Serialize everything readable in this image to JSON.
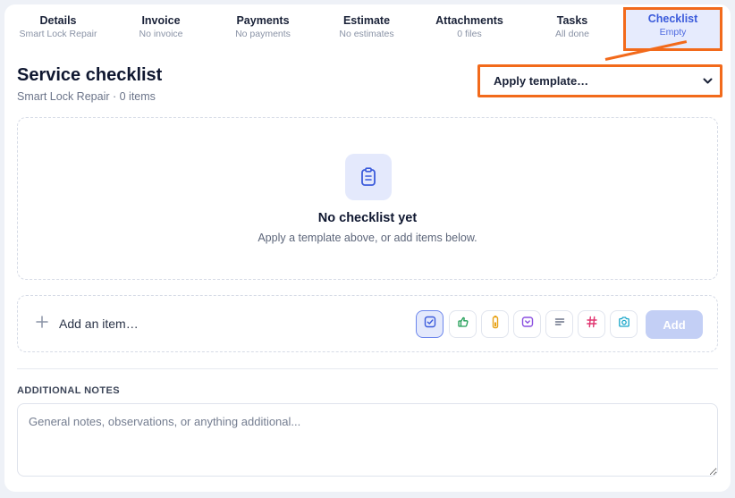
{
  "tabs": [
    {
      "label": "Details",
      "sub": "Smart Lock Repair"
    },
    {
      "label": "Invoice",
      "sub": "No invoice"
    },
    {
      "label": "Payments",
      "sub": "No payments"
    },
    {
      "label": "Estimate",
      "sub": "No estimates"
    },
    {
      "label": "Attachments",
      "sub": "0 files"
    },
    {
      "label": "Tasks",
      "sub": "All done"
    },
    {
      "label": "Checklist",
      "sub": "Empty"
    }
  ],
  "active_tab": "Checklist",
  "header": {
    "title": "Service checklist",
    "subtitle": "Smart Lock Repair · 0 items",
    "template_select": "Apply template…"
  },
  "empty_state": {
    "title": "No checklist yet",
    "message": "Apply a template above, or add items below.",
    "icon": "clipboard-icon"
  },
  "add_item": {
    "placeholder": "Add an item…",
    "add_label": "Add",
    "item_types": [
      {
        "name": "checkbox",
        "icon": "checkbox-icon",
        "color": "#3b5bdb",
        "selected": true
      },
      {
        "name": "thumbs",
        "icon": "thumbs-up-icon",
        "color": "#1f9d55",
        "selected": false
      },
      {
        "name": "battery",
        "icon": "battery-icon",
        "color": "#e8a317",
        "selected": false
      },
      {
        "name": "dropdown",
        "icon": "dropdown-icon",
        "color": "#8a4fe0",
        "selected": false
      },
      {
        "name": "text",
        "icon": "text-lines-icon",
        "color": "#6b7489",
        "selected": false
      },
      {
        "name": "number",
        "icon": "hash-icon",
        "color": "#e0336f",
        "selected": false
      },
      {
        "name": "photo",
        "icon": "camera-icon",
        "color": "#1aa6c9",
        "selected": false
      }
    ]
  },
  "notes": {
    "label": "ADDITIONAL NOTES",
    "placeholder": "General notes, observations, or anything additional..."
  },
  "colors": {
    "accent": "#3b5bdb",
    "highlight": "#f26a1b",
    "add_button": "#c3cff5"
  }
}
